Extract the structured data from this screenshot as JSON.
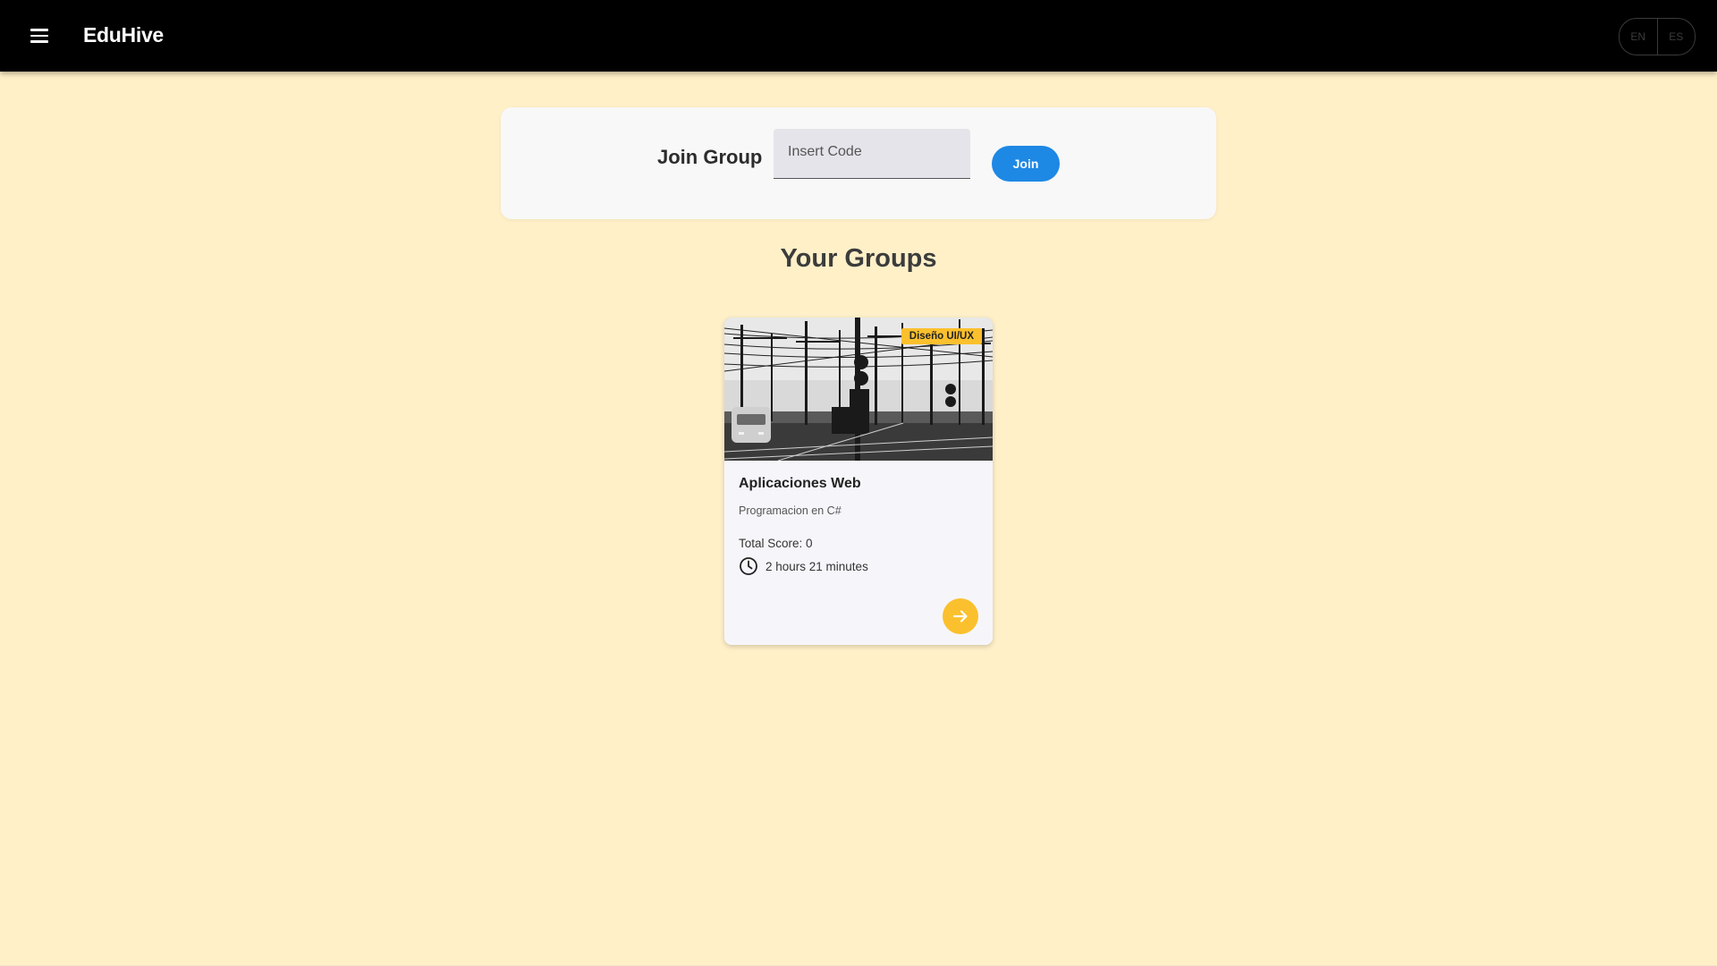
{
  "header": {
    "brand": "EduHive",
    "menu_icon": "menu-icon",
    "languages": [
      "EN",
      "ES"
    ]
  },
  "join": {
    "title": "Join Group",
    "placeholder": "Insert Code",
    "value": "",
    "button_label": "Join"
  },
  "groups": {
    "title": "Your Groups",
    "items": [
      {
        "tag": "Diseño UI/UX",
        "title": "Aplicaciones Web",
        "subtitle": "Programacion en C#",
        "score": "Total Score: 0",
        "time": "2 hours 21 minutes",
        "time_icon": "clock-icon",
        "action_icon": "arrow-right-icon"
      }
    ]
  },
  "colors": {
    "background": "#fff0c8",
    "header": "#000000",
    "primary": "#1e88e5",
    "accent": "#fbc02d"
  }
}
